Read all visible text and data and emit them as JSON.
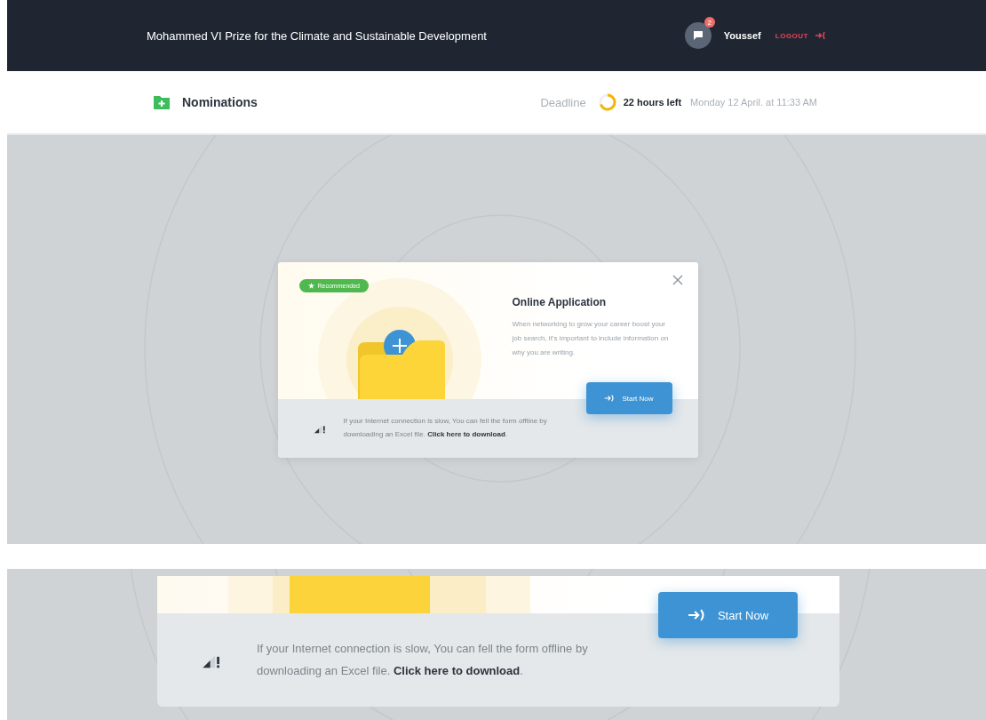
{
  "header": {
    "title": "Mohammed VI Prize for the Climate and Sustainable Development",
    "notifications": "2",
    "user": "Youssef",
    "logout": "LOGOUT"
  },
  "subheader": {
    "title": "Nominations",
    "deadline": {
      "label": "Deadline",
      "remaining": "22 hours left",
      "date": "Monday 12 April. at 11:33 AM"
    }
  },
  "modal": {
    "badge": "Recommended",
    "title": "Online Application",
    "description": "When networking to grow your career boost your job search, it's important to include information on why you are writing.",
    "button": "Start Now",
    "notice": "If your Internet connection is slow, You can fell the form offline by downloading an Excel file. ",
    "notice_link": "Click here to download",
    "notice_end": "."
  },
  "detail": {
    "button": "Start Now",
    "notice": "If your Internet connection is slow, You can fell the form offline by downloading an Excel file. ",
    "notice_link": "Click here to download",
    "notice_end": "."
  }
}
